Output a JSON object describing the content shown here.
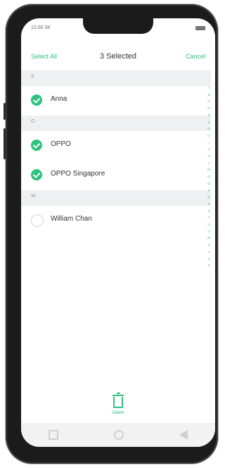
{
  "status": {
    "time": "12:00 34"
  },
  "header": {
    "select_all": "Select All",
    "title": "3 Selected",
    "cancel": "Cancel"
  },
  "sections": [
    {
      "letter": "A",
      "items": [
        {
          "name": "Anna",
          "checked": true
        }
      ]
    },
    {
      "letter": "O",
      "items": [
        {
          "name": "OPPO",
          "checked": true
        },
        {
          "name": "OPPO Singapore",
          "checked": true
        }
      ]
    },
    {
      "letter": "W",
      "items": [
        {
          "name": "William Chan",
          "checked": false
        }
      ]
    }
  ],
  "index_letters": [
    "A",
    "B",
    "C",
    "D",
    "E",
    "F",
    "G",
    "H",
    "I",
    "J",
    "K",
    "L",
    "M",
    "N",
    "O",
    "P",
    "Q",
    "R",
    "S",
    "T",
    "U",
    "V",
    "W",
    "X",
    "Y",
    "Z",
    "#"
  ],
  "bottom": {
    "delete_label": "Delete"
  },
  "colors": {
    "accent": "#2ec27e",
    "section_bg": "#eef0f2"
  }
}
